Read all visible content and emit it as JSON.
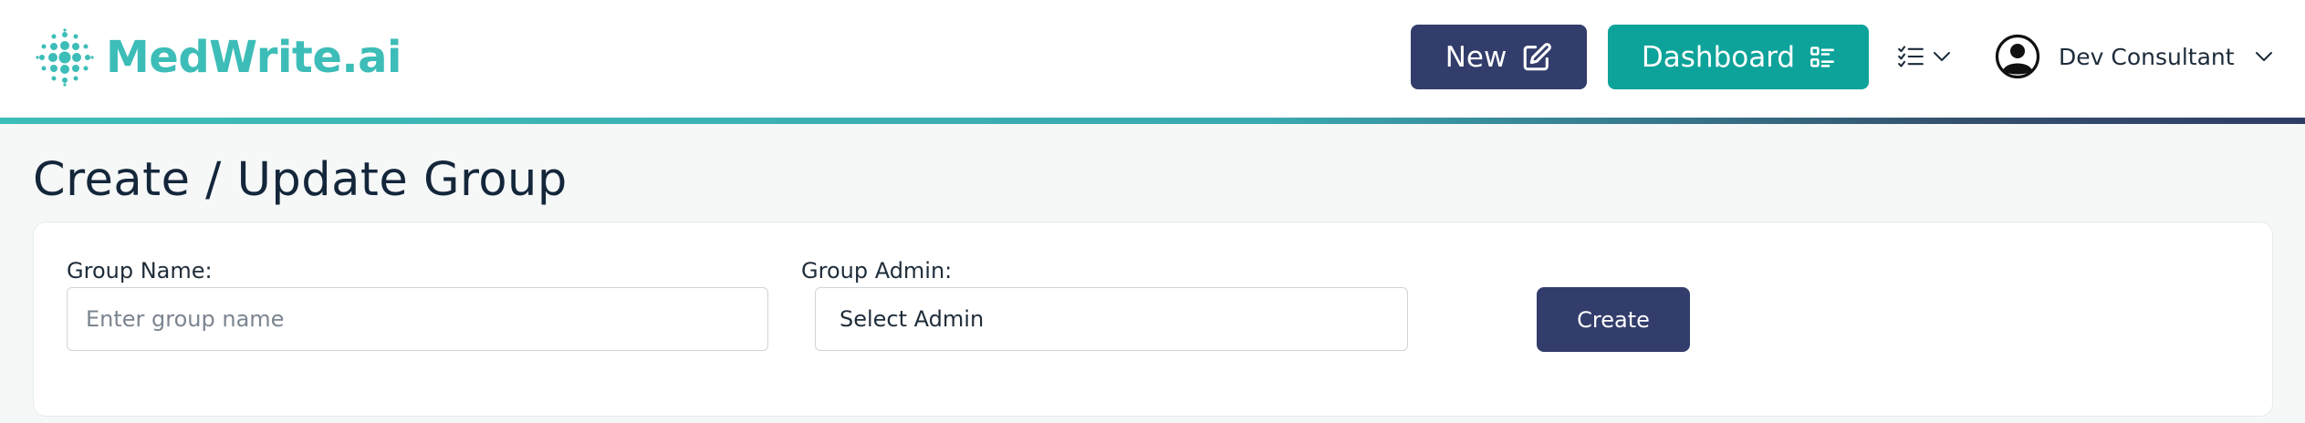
{
  "brand": {
    "name": "MedWrite.ai",
    "color": "#3dbdb8"
  },
  "header": {
    "new_label": "New",
    "new_icon": "edit-square-icon",
    "dashboard_label": "Dashboard",
    "dashboard_icon": "checklist-icon",
    "list_icon": "list-checks-icon",
    "user_icon": "user-circle-icon",
    "user_name": "Dev Consultant",
    "new_color": "#323d6b",
    "dashboard_color": "#0ea39a"
  },
  "page": {
    "title": "Create / Update Group"
  },
  "form": {
    "group_name_label": "Group Name:",
    "group_name_placeholder": "Enter group name",
    "group_name_value": "",
    "group_admin_label": "Group Admin:",
    "group_admin_selected": "Select Admin",
    "create_label": "Create"
  }
}
